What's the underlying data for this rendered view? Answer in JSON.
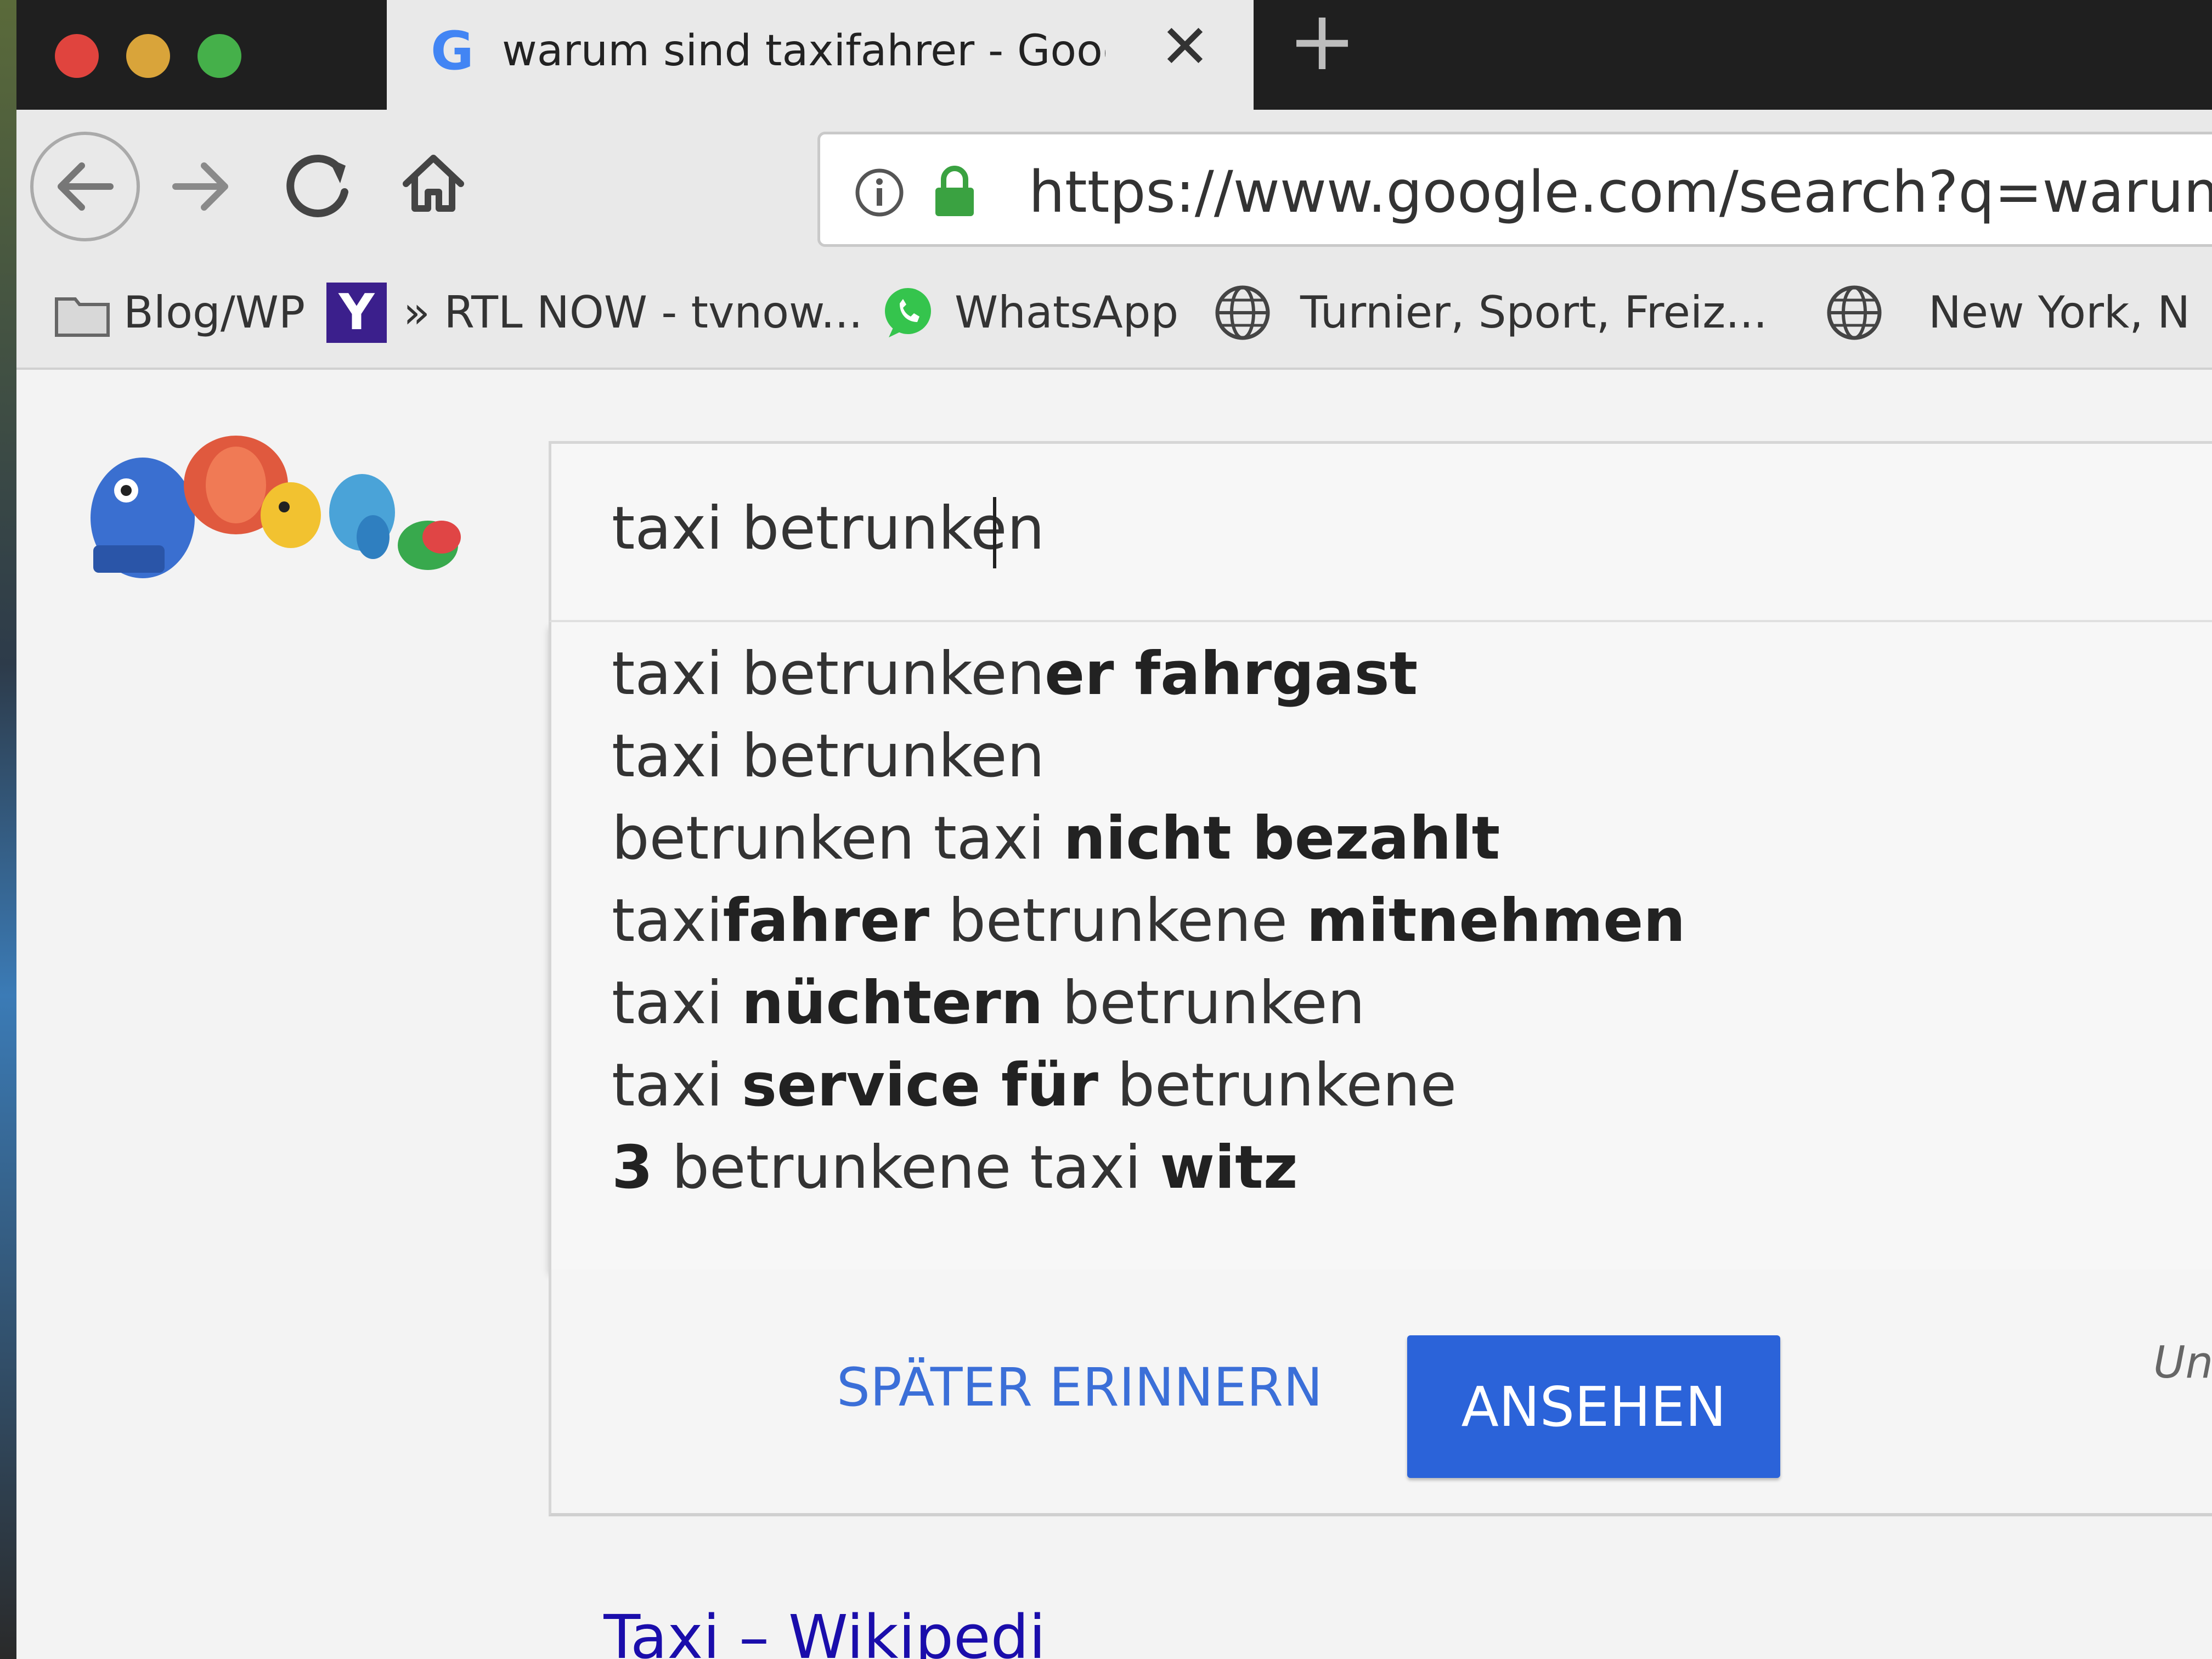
{
  "window": {
    "traffic_lights": {
      "close": "#e0443e",
      "minimize": "#d9a43a",
      "maximize": "#45b04a"
    }
  },
  "tab": {
    "favicon": "G",
    "title": "warum sind taxifahrer - Google",
    "close_glyph": "✕",
    "new_tab_glyph": "+"
  },
  "toolbar": {
    "back_icon": "back-arrow-icon",
    "forward_icon": "forward-arrow-icon",
    "reload_icon": "reload-icon",
    "home_icon": "home-icon",
    "url": "https://www.google.com/search?q=warum+s"
  },
  "bookmarks": [
    {
      "label": "Blog/WP",
      "icon": "folder-icon"
    },
    {
      "label": "» RTL NOW - tvnow...",
      "icon": "yahoo-icon",
      "icon_text": "Y"
    },
    {
      "label": "WhatsApp",
      "icon": "whatsapp-icon"
    },
    {
      "label": "Turnier, Sport, Freiz...",
      "icon": "globe-icon"
    },
    {
      "label": "New York, N",
      "icon": "globe-icon"
    }
  ],
  "search": {
    "query": "taxi betrunken",
    "suggestions": [
      [
        {
          "t": "taxi betrunken",
          "b": false
        },
        {
          "t": "er fahrgast",
          "b": true
        }
      ],
      [
        {
          "t": "taxi betrunken",
          "b": false
        }
      ],
      [
        {
          "t": "betrunken taxi ",
          "b": false
        },
        {
          "t": "nicht bezahlt",
          "b": true
        }
      ],
      [
        {
          "t": "taxi",
          "b": false
        },
        {
          "t": "fahrer",
          "b": true
        },
        {
          "t": " betrunkene ",
          "b": false
        },
        {
          "t": "mitnehmen",
          "b": true
        }
      ],
      [
        {
          "t": "taxi ",
          "b": false
        },
        {
          "t": "nüchtern",
          "b": true
        },
        {
          "t": " betrunken",
          "b": false
        }
      ],
      [
        {
          "t": "taxi ",
          "b": false
        },
        {
          "t": "service für",
          "b": true
        },
        {
          "t": " betrunkene",
          "b": false
        }
      ],
      [
        {
          "t": "3",
          "b": true
        },
        {
          "t": " betrunkene taxi ",
          "b": false
        },
        {
          "t": "witz",
          "b": true
        }
      ]
    ]
  },
  "promo": {
    "later_label": "SPÄTER ERINNERN",
    "view_label": "ANSEHEN",
    "more_label": "Un",
    "accent": "#2b63d9"
  },
  "result": {
    "first_title": "Taxi – Wikipedi"
  }
}
